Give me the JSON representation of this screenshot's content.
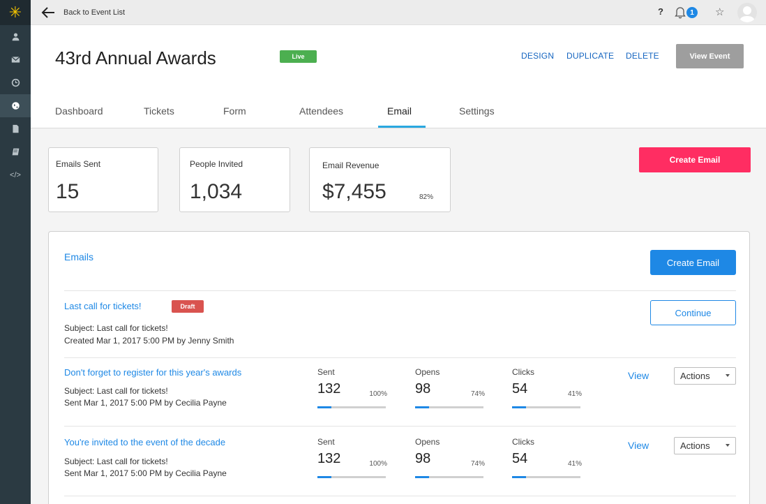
{
  "sidebar": {
    "logo": "✳",
    "items": [
      {
        "icon": "user-icon"
      },
      {
        "icon": "envelope-icon"
      },
      {
        "icon": "clock-icon"
      },
      {
        "icon": "globe-icon",
        "active": true
      },
      {
        "icon": "document-icon"
      },
      {
        "icon": "book-icon"
      },
      {
        "icon": "code-icon",
        "glyph": "</>"
      }
    ]
  },
  "topbar": {
    "back_label": "Back to Event List",
    "help": "?",
    "notifications": "1"
  },
  "header": {
    "title": "43rd Annual Awards",
    "status": "Live",
    "links": {
      "design": "DESIGN",
      "duplicate": "DUPLICATE",
      "delete": "DELETE"
    },
    "view_event": "View Event",
    "tabs": [
      "Dashboard",
      "Tickets",
      "Form",
      "Attendees",
      "Email",
      "Settings"
    ],
    "active_tab": "Email"
  },
  "stats": {
    "emails_sent": {
      "label": "Emails Sent",
      "value": "15"
    },
    "people_invited": {
      "label": "People Invited",
      "value": "1,034"
    },
    "email_revenue": {
      "label": "Email Revenue",
      "value": "$7,455",
      "pct": "82%"
    }
  },
  "create_email_top": "Create Email",
  "emails": {
    "title": "Emails",
    "create_button": "Create Email",
    "rows": [
      {
        "name": "Last call for tickets!",
        "badge": "Draft",
        "subject": "Subject: Last call for tickets!",
        "meta": "Created Mar 1, 2017 5:00 PM by Jenny Smith",
        "continue": "Continue"
      },
      {
        "name": "Don't forget to register for this year's awards",
        "subject": "Subject: Last call for tickets!",
        "meta": "Sent Mar 1, 2017 5:00 PM by Cecilia Payne",
        "metrics": {
          "sent": {
            "label": "Sent",
            "value": "132",
            "pct": "100%",
            "fill": 0.2
          },
          "opens": {
            "label": "Opens",
            "value": "98",
            "pct": "74%",
            "fill": 0.2
          },
          "clicks": {
            "label": "Clicks",
            "value": "54",
            "pct": "41%",
            "fill": 0.2
          }
        },
        "view": "View",
        "actions": "Actions"
      },
      {
        "name": "You're invited to the event of the decade",
        "subject": "Subject: Last call for tickets!",
        "meta": "Sent Mar 1, 2017 5:00 PM by Cecilia Payne",
        "metrics": {
          "sent": {
            "label": "Sent",
            "value": "132",
            "pct": "100%",
            "fill": 0.2
          },
          "opens": {
            "label": "Opens",
            "value": "98",
            "pct": "74%",
            "fill": 0.2
          },
          "clicks": {
            "label": "Clicks",
            "value": "54",
            "pct": "41%",
            "fill": 0.2
          }
        },
        "view": "View",
        "actions": "Actions"
      }
    ]
  },
  "colors": {
    "sidebar_bg": "#2b3a42",
    "primary_blue": "#1e88e5",
    "create_pink": "#ff2d62",
    "live_green": "#4caf50",
    "draft_red": "#d9534f",
    "tab_accent": "#29a8e0"
  }
}
